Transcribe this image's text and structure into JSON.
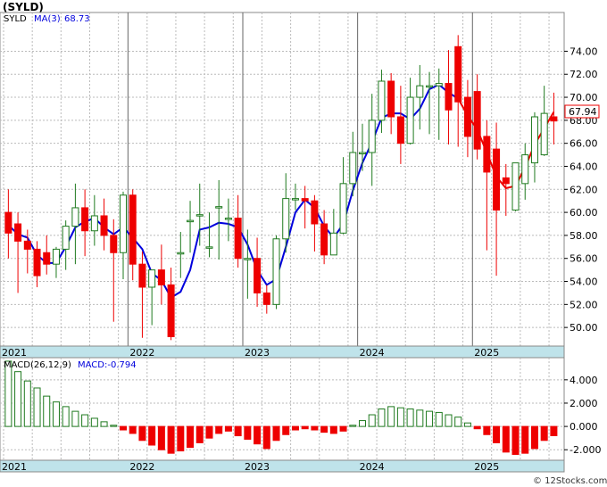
{
  "header": {
    "symbol": "(SYLD)"
  },
  "price_legend": {
    "symbol": "SYLD",
    "ma_label": "MA(3)",
    "ma_value": "68.73"
  },
  "macd_legend": {
    "label": "MACD(26,12,9)",
    "value_label": "MACD:-0.794"
  },
  "last_price": "67.94",
  "credit": "© 12Stocks.com",
  "colors": {
    "up": "#1f7a1f",
    "down": "#ee0000",
    "ma": "#0000dd",
    "ma_down": "#ee0000",
    "grid": "#bbbbbb",
    "axis_band": "#bfe3ea"
  },
  "chart_data": [
    {
      "type": "candlestick",
      "title": "(SYLD)",
      "x_ticks": [
        "2021",
        "2022",
        "2023",
        "2024",
        "2025"
      ],
      "y_ticks": [
        "74.00",
        "72.00",
        "70.00",
        "68.00",
        "66.00",
        "64.00",
        "62.00",
        "60.00",
        "58.00",
        "56.00",
        "54.00",
        "52.00",
        "50.00"
      ],
      "ylim": [
        48.5,
        75.7
      ],
      "grid": true,
      "x": [
        "2020-12",
        "2021-01",
        "2021-02",
        "2021-03",
        "2021-04",
        "2021-05",
        "2021-06",
        "2021-07",
        "2021-08",
        "2021-09",
        "2021-10",
        "2021-11",
        "2021-12",
        "2022-01",
        "2022-02",
        "2022-03",
        "2022-04",
        "2022-05",
        "2022-06",
        "2022-07",
        "2022-08",
        "2022-09",
        "2022-10",
        "2022-11",
        "2022-12",
        "2023-01",
        "2023-02",
        "2023-03",
        "2023-04",
        "2023-05",
        "2023-06",
        "2023-07",
        "2023-08",
        "2023-09",
        "2023-10",
        "2023-11",
        "2023-12",
        "2024-01",
        "2024-02",
        "2024-03",
        "2024-04",
        "2024-05",
        "2024-06",
        "2024-07",
        "2024-08",
        "2024-09",
        "2024-10",
        "2024-11",
        "2024-12",
        "2025-01",
        "2025-02",
        "2025-03",
        "2025-04",
        "2025-05",
        "2025-06",
        "2025-07",
        "2025-08",
        "2025-09"
      ],
      "open": [
        60.0,
        59.0,
        57.5,
        56.8,
        56.5,
        55.5,
        56.8,
        58.8,
        60.4,
        58.4,
        59.7,
        58.0,
        56.5,
        61.5,
        55.5,
        53.5,
        55.0,
        53.7,
        56.5,
        59.3,
        59.8,
        57.0,
        60.5,
        59.5,
        59.5,
        56.0,
        56.0,
        53.0,
        52.0,
        57.7,
        61.2,
        61.2,
        61.0,
        59.0,
        56.3,
        58.2,
        62.5,
        65.2,
        65.2,
        68.0,
        71.4,
        68.3,
        66.0,
        70.0,
        71.0,
        71.0,
        71.2,
        74.4,
        70.0,
        70.5,
        66.6,
        65.5,
        63.0,
        60.2,
        62.5,
        64.3,
        65.0,
        68.3
      ],
      "close": [
        58.2,
        57.5,
        56.8,
        54.5,
        55.5,
        56.8,
        58.8,
        60.4,
        58.4,
        59.7,
        58.0,
        56.5,
        61.5,
        55.5,
        53.5,
        55.0,
        53.7,
        49.2,
        56.5,
        59.3,
        59.8,
        57.0,
        60.5,
        59.5,
        56.0,
        56.0,
        53.0,
        52.0,
        57.7,
        61.2,
        61.2,
        61.0,
        59.0,
        56.3,
        58.2,
        62.5,
        65.2,
        65.2,
        68.0,
        71.4,
        68.3,
        66.0,
        70.0,
        71.0,
        71.0,
        71.2,
        68.9,
        69.6,
        66.6,
        65.5,
        63.5,
        60.2,
        62.5,
        64.3,
        65.0,
        68.3,
        68.6,
        67.94
      ],
      "high": [
        62.0,
        60.0,
        58.5,
        57.5,
        58.0,
        57.0,
        59.3,
        62.5,
        62.0,
        61.5,
        61.2,
        59.4,
        61.8,
        62.0,
        56.6,
        54.3,
        57.2,
        55.2,
        58.3,
        61.0,
        62.5,
        60.0,
        62.8,
        61.2,
        61.5,
        58.5,
        57.8,
        53.7,
        58.0,
        63.4,
        62.5,
        62.3,
        61.5,
        60.2,
        60.3,
        64.8,
        67.0,
        67.7,
        70.3,
        72.4,
        72.1,
        71.0,
        71.7,
        72.8,
        72.2,
        72.5,
        74.1,
        75.4,
        71.5,
        72.0,
        68.0,
        67.8,
        64.2,
        62.3,
        66.0,
        68.7,
        71.0,
        70.4
      ],
      "low": [
        56.0,
        53.0,
        54.7,
        53.5,
        54.6,
        54.3,
        55.0,
        55.5,
        56.2,
        57.1,
        56.7,
        50.5,
        54.2,
        54.1,
        49.1,
        50.2,
        52.0,
        48.9,
        54.3,
        56.5,
        57.1,
        56.1,
        55.9,
        57.5,
        55.2,
        52.5,
        51.8,
        51.2,
        51.6,
        56.5,
        60.2,
        58.6,
        56.6,
        55.5,
        56.4,
        58.1,
        61.4,
        63.6,
        62.3,
        66.9,
        66.8,
        64.2,
        65.9,
        67.2,
        66.8,
        66.3,
        65.9,
        65.7,
        64.8,
        64.6,
        56.7,
        54.5,
        59.7,
        60.1,
        61.1,
        62.6,
        64.9,
        65.9
      ],
      "ma3": [
        58.9,
        58.1,
        57.8,
        56.3,
        55.6,
        55.6,
        57.0,
        58.7,
        59.2,
        59.5,
        58.7,
        58.1,
        58.7,
        57.8,
        56.8,
        54.7,
        54.1,
        52.6,
        53.1,
        55.0,
        58.5,
        58.7,
        59.1,
        59.0,
        58.7,
        57.2,
        55.0,
        53.7,
        54.2,
        57.0,
        60.0,
        61.1,
        60.4,
        58.8,
        57.8,
        59.0,
        61.9,
        64.3,
        66.1,
        68.2,
        68.6,
        68.6,
        68.1,
        69.0,
        70.7,
        71.1,
        70.4,
        69.9,
        68.4,
        67.2,
        65.2,
        63.1,
        62.1,
        62.3,
        63.9,
        65.9,
        67.3,
        68.73
      ],
      "ma_down_from_index": 47
    },
    {
      "type": "bar",
      "title": "MACD(26,12,9)",
      "y_ticks": [
        "4.000",
        "2.000",
        "0.000",
        "-2.000"
      ],
      "ylim": [
        -2.9,
        5.9
      ],
      "grid": true,
      "values": [
        5.6,
        4.7,
        3.9,
        3.3,
        2.6,
        2.1,
        1.7,
        1.3,
        1.0,
        0.7,
        0.4,
        0.1,
        -0.3,
        -0.6,
        -1.2,
        -1.6,
        -2.0,
        -2.3,
        -2.1,
        -1.8,
        -1.4,
        -1.0,
        -0.6,
        -0.4,
        -0.8,
        -1.1,
        -1.5,
        -1.9,
        -1.2,
        -0.7,
        -0.3,
        -0.2,
        -0.3,
        -0.5,
        -0.6,
        -0.4,
        0.1,
        0.5,
        1.0,
        1.5,
        1.7,
        1.6,
        1.5,
        1.4,
        1.3,
        1.2,
        1.0,
        0.8,
        0.3,
        -0.2,
        -0.7,
        -1.4,
        -2.2,
        -2.4,
        -2.3,
        -1.9,
        -1.2,
        -0.794
      ]
    }
  ]
}
